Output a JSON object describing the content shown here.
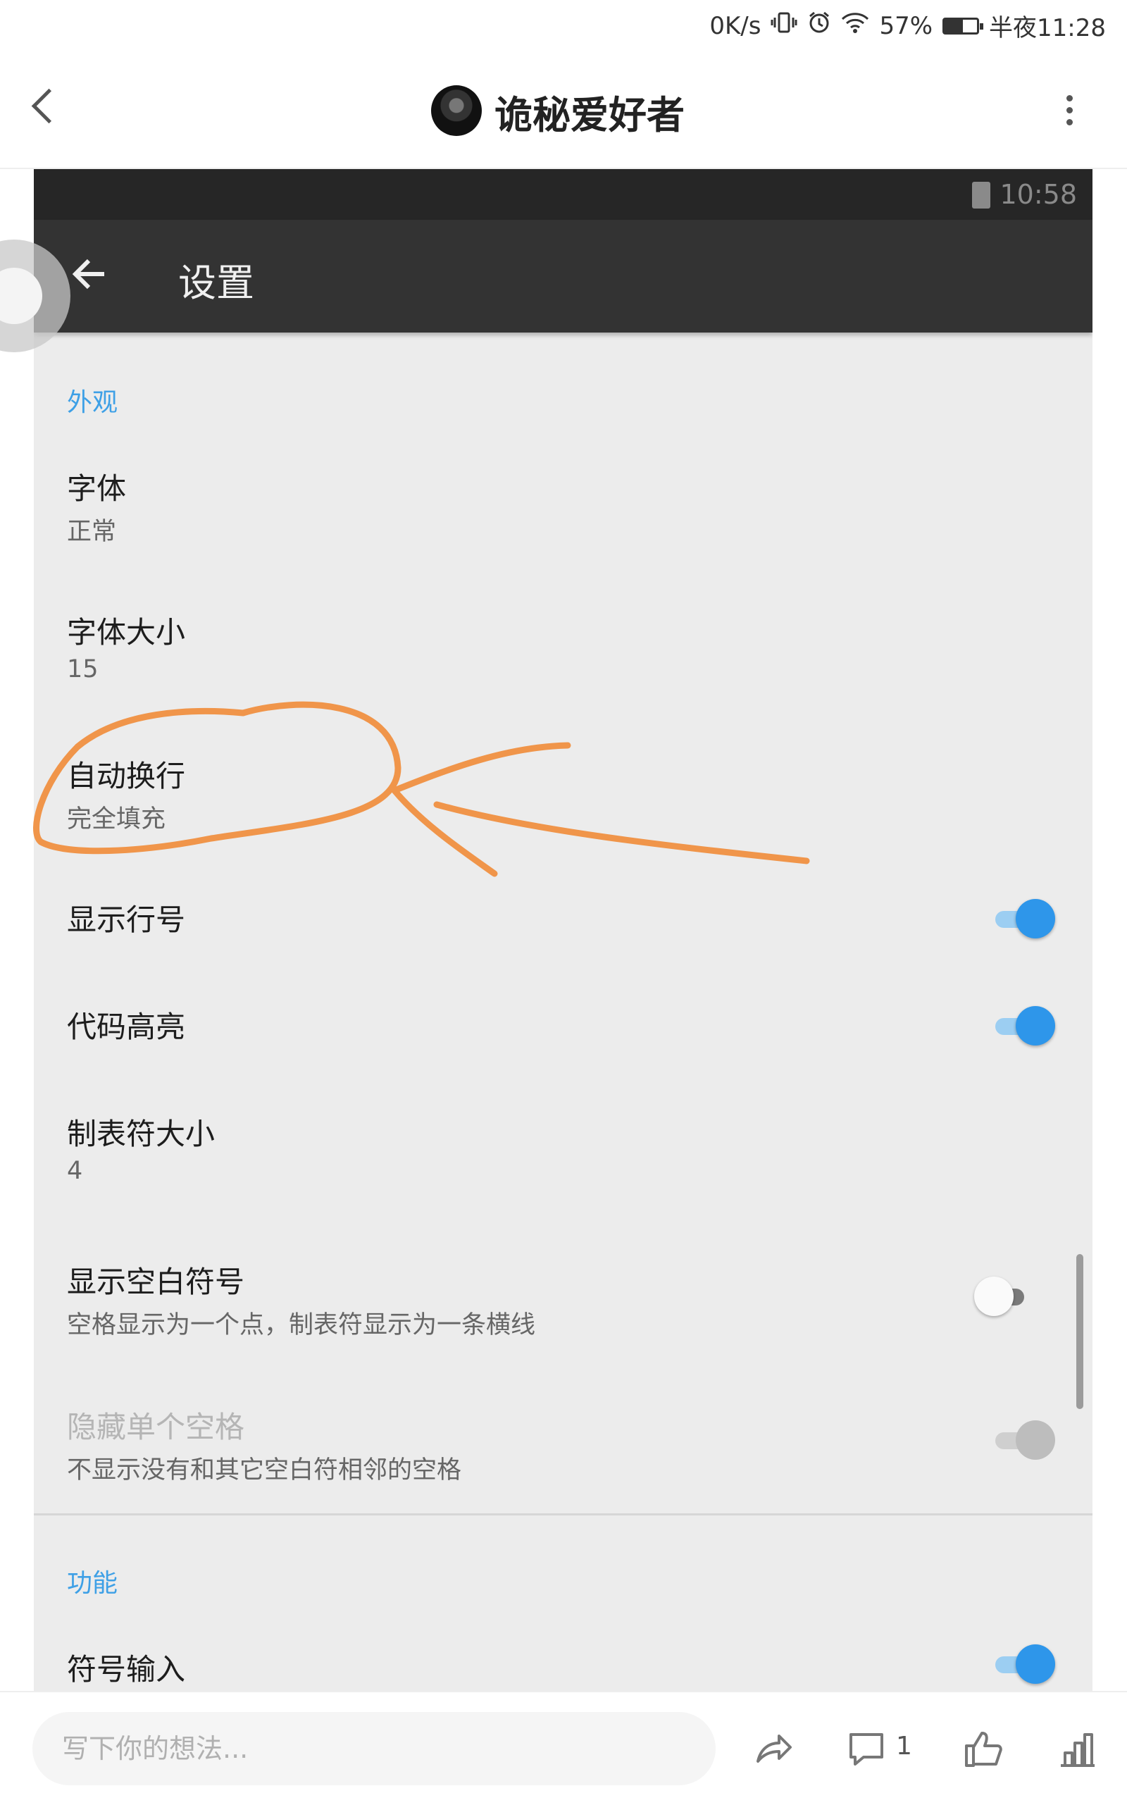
{
  "status_bar": {
    "net_speed": "0K/s",
    "battery": "57%",
    "time": "半夜11:28",
    "battery_level": 0.57
  },
  "top_bar": {
    "title": "诡秘爱好者"
  },
  "embedded": {
    "status_time": "10:58",
    "title": "设置",
    "sections": [
      {
        "header": "外观"
      },
      {
        "header": "功能"
      }
    ],
    "items": [
      {
        "title": "字体",
        "subtitle": "正常"
      },
      {
        "title": "字体大小",
        "subtitle": "15"
      },
      {
        "title": "自动换行",
        "subtitle": "完全填充"
      },
      {
        "title": "显示行号",
        "switch": "on"
      },
      {
        "title": "代码高亮",
        "switch": "on"
      },
      {
        "title": "制表符大小",
        "subtitle": "4"
      },
      {
        "title": "显示空白符号",
        "subtitle": "空格显示为一个点，制表符显示为一条横线",
        "switch": "off"
      },
      {
        "title": "隐藏单个空格",
        "subtitle": "不显示没有和其它空白符相邻的空格",
        "switch": "disabled"
      },
      {
        "title": "符号输入",
        "switch": "on"
      }
    ]
  },
  "annotation_color": "#f0954a",
  "bottom_bar": {
    "placeholder": "写下你的想法...",
    "comment_count": "1"
  },
  "colors": {
    "accent": "#3ea0e6",
    "switch_on": "#2e96ea"
  }
}
